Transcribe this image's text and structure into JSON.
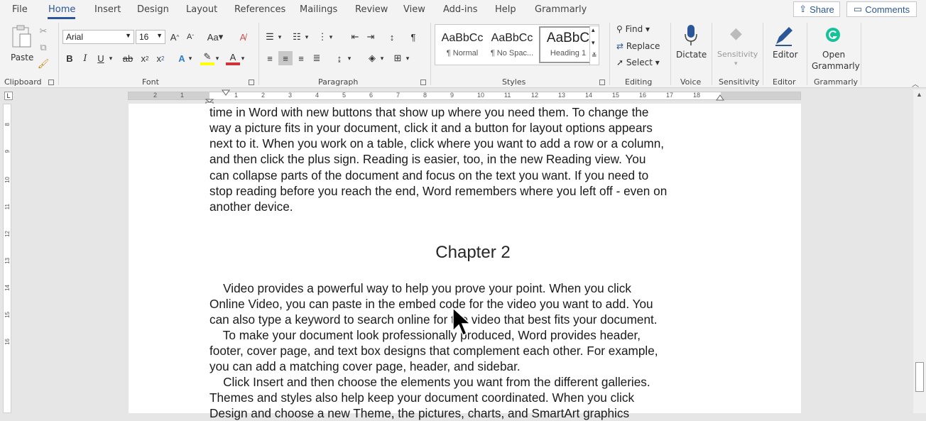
{
  "tabs": [
    "File",
    "Home",
    "Insert",
    "Design",
    "Layout",
    "References",
    "Mailings",
    "Review",
    "View",
    "Add-ins",
    "Help",
    "Grammarly"
  ],
  "share_label": "Share",
  "comments_label": "Comments",
  "clipboard": {
    "paste_label": "Paste",
    "group_label": "Clipboard"
  },
  "font": {
    "name": "Arial",
    "size": "16",
    "group_label": "Font",
    "change_case": "Aa"
  },
  "paragraph": {
    "group_label": "Paragraph"
  },
  "styles": {
    "items": [
      {
        "sample": "AaBbCc",
        "name": "¶ Normal"
      },
      {
        "sample": "AaBbCc",
        "name": "¶ No Spac..."
      },
      {
        "sample": "AaBbC",
        "name": "Heading 1"
      }
    ],
    "group_label": "Styles"
  },
  "editing": {
    "find": "Find",
    "replace": "Replace",
    "select": "Select",
    "group_label": "Editing"
  },
  "voice": {
    "dictate": "Dictate",
    "group_label": "Voice"
  },
  "sensitivity": {
    "label": "Sensitivity",
    "group_label": "Sensitivity"
  },
  "editor": {
    "label": "Editor",
    "group_label": "Editor"
  },
  "grammarly": {
    "line1": "Open",
    "line2": "Grammarly",
    "group_label": "Grammarly"
  },
  "ruler_numbers": [
    "2",
    "1",
    "1",
    "2",
    "3",
    "4",
    "5",
    "6",
    "7",
    "8",
    "9",
    "10",
    "11",
    "12",
    "13",
    "14",
    "15",
    "16",
    "17",
    "18"
  ],
  "vruler_numbers": [
    "8",
    "9",
    "10",
    "11",
    "12",
    "13",
    "14",
    "15",
    "16"
  ],
  "document": {
    "para1_lines": [
      "time in Word with new buttons that show up where you need them. To change the",
      "way a picture fits in your document, click it and a button for layout options appears",
      "next to it. When you work on a table, click where you want to add a row or a column,",
      "and then click the plus sign. Reading is easier, too, in the new Reading view. You",
      "can collapse parts of the document and focus on the text you want. If you need to",
      "stop reading before you reach the end, Word remembers where you left off - even on",
      "another device."
    ],
    "heading": "Chapter 2",
    "para2_lines": [
      "    Video provides a powerful way to help you prove your point. When you click",
      "Online Video, you can paste in the embed code for the video you want to add. You",
      "can also type a keyword to search online for the video that best fits your document.",
      "    To make your document look professionally produced, Word provides header,",
      "footer, cover page, and text box designs that complement each other. For example,",
      "you can add a matching cover page, header, and sidebar.",
      "    Click Insert and then choose the elements you want from the different galleries.",
      "Themes and styles also help keep your document coordinated. When you click",
      "Design and choose a new Theme, the pictures, charts, and SmartArt graphics"
    ]
  },
  "colors": {
    "accent": "#2b579a",
    "highlight": "#ffff00",
    "font_color": "#d13438",
    "grammarly": "#15c39a"
  }
}
